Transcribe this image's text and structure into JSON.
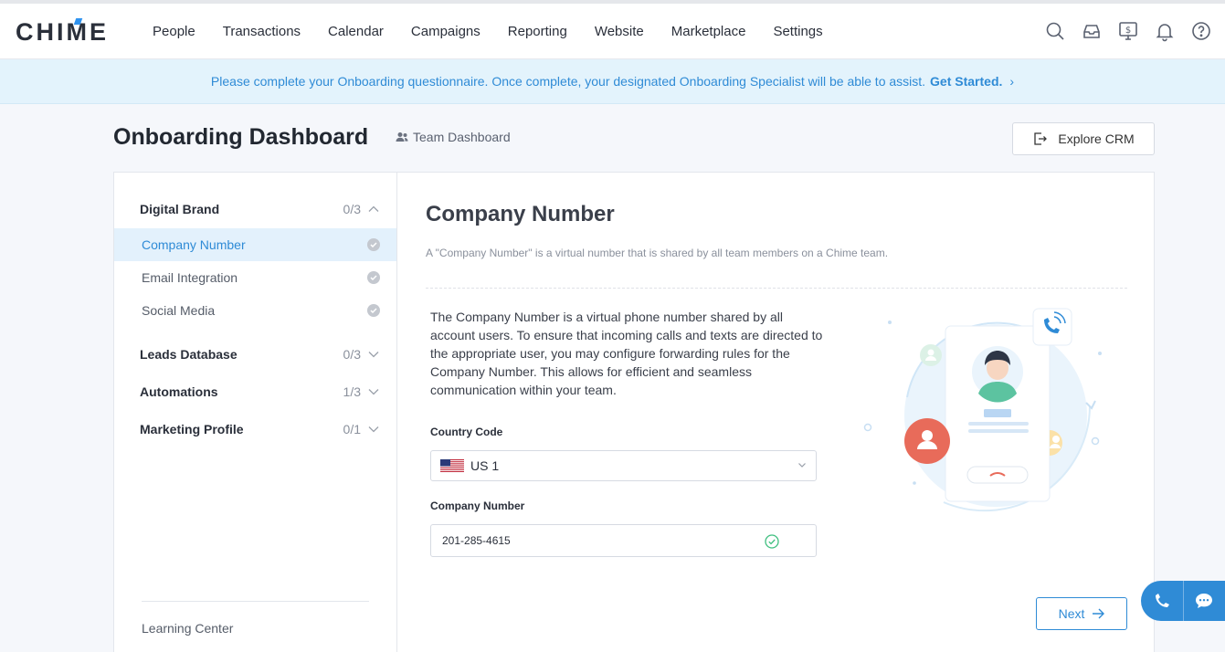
{
  "app": {
    "logo": "CHIME"
  },
  "nav": {
    "items": [
      "People",
      "Transactions",
      "Calendar",
      "Campaigns",
      "Reporting",
      "Website",
      "Marketplace",
      "Settings"
    ]
  },
  "banner": {
    "text": "Please complete your Onboarding questionnaire. Once complete, your designated Onboarding Specialist will be able to assist.",
    "cta": "Get Started.",
    "chevron": "›"
  },
  "header": {
    "title": "Onboarding Dashboard",
    "team_dashboard": "Team Dashboard",
    "explore_crm": "Explore CRM"
  },
  "sidebar": {
    "sections": [
      {
        "title": "Digital Brand",
        "progress": "0/3",
        "expanded": true,
        "items": [
          "Company Number",
          "Email Integration",
          "Social Media"
        ]
      },
      {
        "title": "Leads Database",
        "progress": "0/3",
        "expanded": false
      },
      {
        "title": "Automations",
        "progress": "1/3",
        "expanded": false
      },
      {
        "title": "Marketing Profile",
        "progress": "0/1",
        "expanded": false
      }
    ],
    "active_item": "Company Number",
    "learning_center": "Learning Center"
  },
  "main": {
    "title": "Company Number",
    "description": "A \"Company Number\" is a virtual number that is shared by all team members on a Chime team.",
    "paragraph": "The Company Number is a virtual phone number shared by all account users. To ensure that incoming calls and texts are directed to the appropriate user, you may configure forwarding rules for the Company Number. This allows for efficient and seamless communication within your team.",
    "country_code_label": "Country Code",
    "country_code_value": "US 1",
    "company_number_label": "Company Number",
    "company_number_value": "201-285-4615",
    "next_label": "Next"
  },
  "colors": {
    "accent": "#2f8bd6",
    "banner_bg": "#e3f3fc",
    "success": "#3fbf7f"
  }
}
